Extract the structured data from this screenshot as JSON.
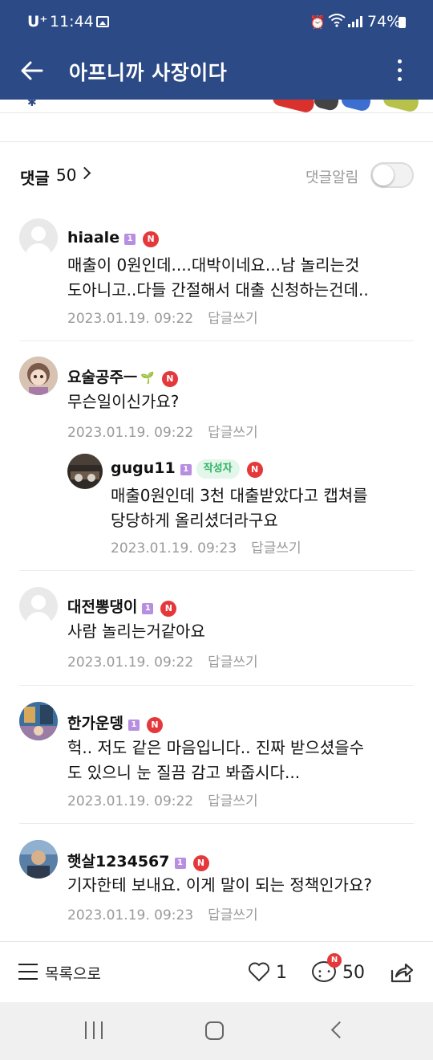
{
  "status_bar": {
    "carrier": "U⁺",
    "time": "11:44",
    "battery": "74%"
  },
  "header": {
    "title": "아프니까 사장이다"
  },
  "comments_header": {
    "label": "댓글",
    "count": "50",
    "alarm_label": "댓글알림",
    "alarm_enabled": false
  },
  "badges": {
    "level": "1",
    "new": "N",
    "author": "작성자"
  },
  "comments": [
    {
      "nickname": "hiaale",
      "lines": [
        "매출이 0원인데....대박이네요...남 놀리는것",
        "도아니고..다들 간절해서 대출 신청하는건데.."
      ],
      "date": "2023.01.19. 09:22",
      "reply_label": "답글쓰기"
    },
    {
      "nickname": "요술공주ㅡ",
      "lines": [
        "무슨일이신가요?"
      ],
      "date": "2023.01.19. 09:22",
      "reply_label": "답글쓰기"
    },
    {
      "nickname": "gugu11",
      "lines": [
        "매출0원인데 3천 대출받았다고 캡쳐를",
        "당당하게 올리셨더라구요"
      ],
      "date": "2023.01.19. 09:23",
      "reply_label": "답글쓰기"
    },
    {
      "nickname": "대전뽕댕이",
      "lines": [
        "사람 놀리는거같아요"
      ],
      "date": "2023.01.19. 09:22",
      "reply_label": "답글쓰기"
    },
    {
      "nickname": "한가운뎅",
      "lines": [
        "헉.. 저도 같은 마음입니다.. 진짜 받으셨을수",
        "도 있으니 눈 질끔 감고 봐줍시다..."
      ],
      "date": "2023.01.19. 09:22",
      "reply_label": "답글쓰기"
    },
    {
      "nickname": "햇살1234567",
      "lines": [
        "기자한테 보내요. 이게 말이 되는 정책인가요?"
      ],
      "date": "2023.01.19. 09:23",
      "reply_label": "답글쓰기"
    }
  ],
  "bottom_bar": {
    "list_label": "목록으로",
    "like_count": "1",
    "comment_count": "50",
    "comment_badge": "N"
  },
  "icons": {
    "back": "arrow-left-icon",
    "more": "more-vertical-icon",
    "list": "list-icon",
    "like": "heart-icon",
    "comment": "comment-bubble-icon",
    "share": "share-icon"
  },
  "colors": {
    "header_bg": "#2b4a86",
    "new_badge": "#e5383b",
    "level_badge": "#b78ee0",
    "author_tag_text": "#2fb463"
  }
}
